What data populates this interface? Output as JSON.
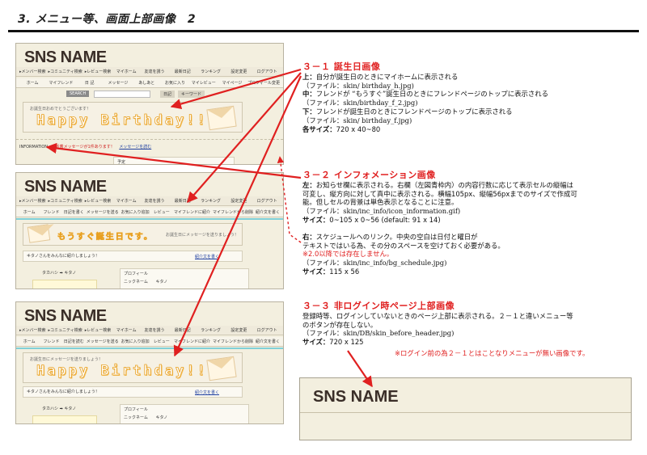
{
  "document": {
    "title": "3. メニュー等、画面上部画像　2"
  },
  "colors": {
    "accent_red": "#e02020",
    "mock_bg": "#f3efdf",
    "brand_text": "#3a2e28",
    "birthday_orange": "#e8a020"
  },
  "mock1": {
    "brand": "SNS NAME",
    "nav_top": [
      "▸メンバー検索",
      "▸コミュニティ検索",
      "▸レビュー検索",
      "マイホーム",
      "友達を誘う",
      "最新日記",
      "ランキング",
      "設定変更",
      "ログアウト"
    ],
    "nav_main": [
      "ホーム",
      "マイフレンド",
      "日 記",
      "メッセージ",
      "あしあと",
      "お気に入り",
      "マイレビュー",
      "マイページ",
      "プロフィール変更"
    ],
    "search_label": "SEARCH",
    "tab_diary": "日記",
    "tab_keyword": "キーワード",
    "banner_small": "お誕生日おめでとうございます！",
    "banner_big": "Happy Birthday!!",
    "info_label": "INFORMATION",
    "info_message": "新着メッセージが1件あります！",
    "info_link": "メッセージを読む",
    "schedule_label": "予定"
  },
  "mock2": {
    "brand": "SNS NAME",
    "nav_top": [
      "▸メンバー検索",
      "▸コミュニティ検索",
      "▸レビュー検索",
      "マイホーム",
      "友達を誘う",
      "最新日記",
      "ランキング",
      "設定変更",
      "ログアウト"
    ],
    "nav_main": [
      "ホーム",
      "フレンド",
      "日記を書く",
      "メッセージを送る",
      "お気に入り追加",
      "レビュー",
      "マイフレンドに紹介",
      "マイフレンドから削除",
      "紹介文を書く"
    ],
    "banner_text": "もうすぐ誕生日です。",
    "banner_right": "お誕生日にメッセージを送りましょう！",
    "intro_text": "キタノさんをみんなに紹介しましょう！",
    "intro_link": "紹介文を書く",
    "friend_name": "タカハシ ➡ キタノ",
    "profile_title": "プロフィール",
    "nickname_label": "ニックネーム",
    "nickname_value": "キタノ"
  },
  "mock3": {
    "brand": "SNS NAME",
    "nav_top": [
      "▸メンバー検索",
      "▸コミュニティ検索",
      "▸レビュー検索",
      "マイホーム",
      "友達を誘う",
      "最新日記",
      "ランキング",
      "設定変更",
      "ログアウト"
    ],
    "nav_main": [
      "ホーム",
      "フレンド",
      "日記を読む",
      "メッセージを送る",
      "お気に入り追加",
      "レビュー",
      "マイフレンドに紹介",
      "マイフレンドから削除",
      "紹介文を書く"
    ],
    "banner_small": "お誕生日にメッセージを送りましょう！",
    "banner_big": "Happy Birthday!!",
    "intro_text": "キタノさんをみんなに紹介しましょう！",
    "intro_link": "紹介文を書く",
    "friend_name": "タカハシ ➡ キタノ",
    "profile_title": "プロフィール",
    "nickname_label": "ニックネーム",
    "nickname_value": "キタノ"
  },
  "notes": {
    "s31": {
      "title": "３－１ 誕生日画像",
      "l1_b": "上：",
      "l1": "自分が誕生日のときにマイホームに表示される",
      "l2": "（ファイル：skin/ birthday_h.jpg)",
      "l3_b": "中：",
      "l3": "フレンドが “もうすぐ”誕生日のときにフレンドページのトップに表示される",
      "l4": "（ファイル：skin/birthday_f_2.jpg)",
      "l5_b": "下：",
      "l5": "フレンドが誕生日のときにフレンドページのトップに表示される",
      "l6": "（ファイル：skin/ birthday_f.jpg)",
      "l7_b": "各サイズ：",
      "l7": "720 x 40~80"
    },
    "s32": {
      "title": "３－２ インフォメーション画像",
      "l1_b": "左：",
      "l1": "お知らせ欄に表示される。右欄（左図青枠内）の内容行数に応じて表示セルの縦幅は",
      "l2": "可変し、縦方向に対して真中に表示される。横幅105px、縦幅56pxまでのサイズで作成可",
      "l3": "能。但しセルの背景は単色表示となることに注意。",
      "l4": "（ファイル：skin/inc_info/icon_information.gif)",
      "l5_b": "サイズ：",
      "l5": "0~105 x 0~56 (default: 91 x 14)",
      "l6_b": "右：",
      "l6": "スケジュールへのリンク。中央の空白は日付と曜日が",
      "l7": "テキストではいる為、その分のスペースを空けておく必要がある。",
      "l8": "※2.0以降では存在しません。",
      "l9": "（ファイル：skin/inc_info/bg_schedule.jpg)",
      "l10_b": "サイズ：",
      "l10": "115 x 56"
    },
    "s33": {
      "title": "３－３ 非ログイン時ページ上部画像",
      "l1": "登録時等、ログインしていないときのページ上部に表示される。２－１と違いメニュー等",
      "l2": "のボタンが存在しない。",
      "l3": "（ファイル：skin/DB/skin_before_header.jpg)",
      "l4_b": "サイズ：",
      "l4": "720 x 125"
    },
    "red_note": "※ログイン前の為２－１とはことなりメニューが無い画像です。"
  },
  "result": {
    "brand": "SNS NAME"
  }
}
